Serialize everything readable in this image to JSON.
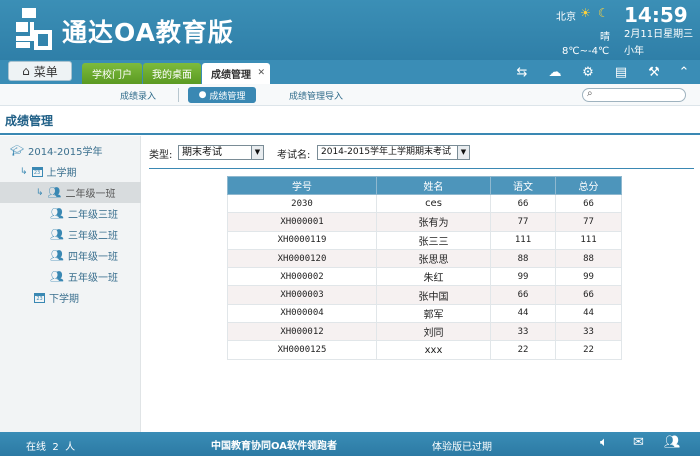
{
  "app": {
    "title": "通达OA教育版"
  },
  "weather": {
    "city": "北京",
    "condition": "晴",
    "temperature": "8℃~-4℃"
  },
  "clock": {
    "time": "14:59",
    "date": "2月11日星期三",
    "solar_term": "小年"
  },
  "menu_button": {
    "label": "菜单"
  },
  "tabs": [
    {
      "label": "学校门户"
    },
    {
      "label": "我的桌面"
    },
    {
      "label": "成绩管理",
      "active": true
    }
  ],
  "toolbar_icons": [
    "switch-icon",
    "cloud-icon",
    "gear-icon",
    "notebook-icon",
    "wrench-icon",
    "chevron-up-icon"
  ],
  "subnav": {
    "items": [
      "成绩录入",
      "成绩管理",
      "成绩管理导入"
    ],
    "active_index": 1,
    "search_placeholder": ""
  },
  "page_title": "成绩管理",
  "sidebar": {
    "root": "2014-2015学年",
    "term1": "上学期",
    "classes": [
      "二年级一班",
      "二年级三班",
      "三年级二班",
      "四年级一班",
      "五年级一班"
    ],
    "selected_class_index": 0,
    "term2": "下学期"
  },
  "filters": {
    "type_label": "类型:",
    "type_value": "期末考试",
    "exam_label": "考试名:",
    "exam_value": "2014-2015学年上学期期末考试"
  },
  "table": {
    "headers": [
      "学号",
      "姓名",
      "语文",
      "总分"
    ],
    "rows": [
      [
        "2030",
        "ces",
        "66",
        "66"
      ],
      [
        "XH000001",
        "张有为",
        "77",
        "77"
      ],
      [
        "XH0000119",
        "张三三",
        "111",
        "111"
      ],
      [
        "XH0000120",
        "张思思",
        "88",
        "88"
      ],
      [
        "XH000002",
        "朱红",
        "99",
        "99"
      ],
      [
        "XH000003",
        "张中国",
        "66",
        "66"
      ],
      [
        "XH000004",
        "郭军",
        "44",
        "44"
      ],
      [
        "XH000012",
        "刘同",
        "33",
        "33"
      ],
      [
        "XH0000125",
        "xxx",
        "22",
        "22"
      ]
    ]
  },
  "footer": {
    "online_label": "在线",
    "online_count": "2",
    "online_unit": "人",
    "slogan": "中国教育协同OA软件领跑者",
    "trial_notice": "体验版已过期"
  },
  "colors": {
    "header": "#3b8fb6",
    "tab_green": "#6aa82e",
    "accent": "#3a88b3"
  }
}
